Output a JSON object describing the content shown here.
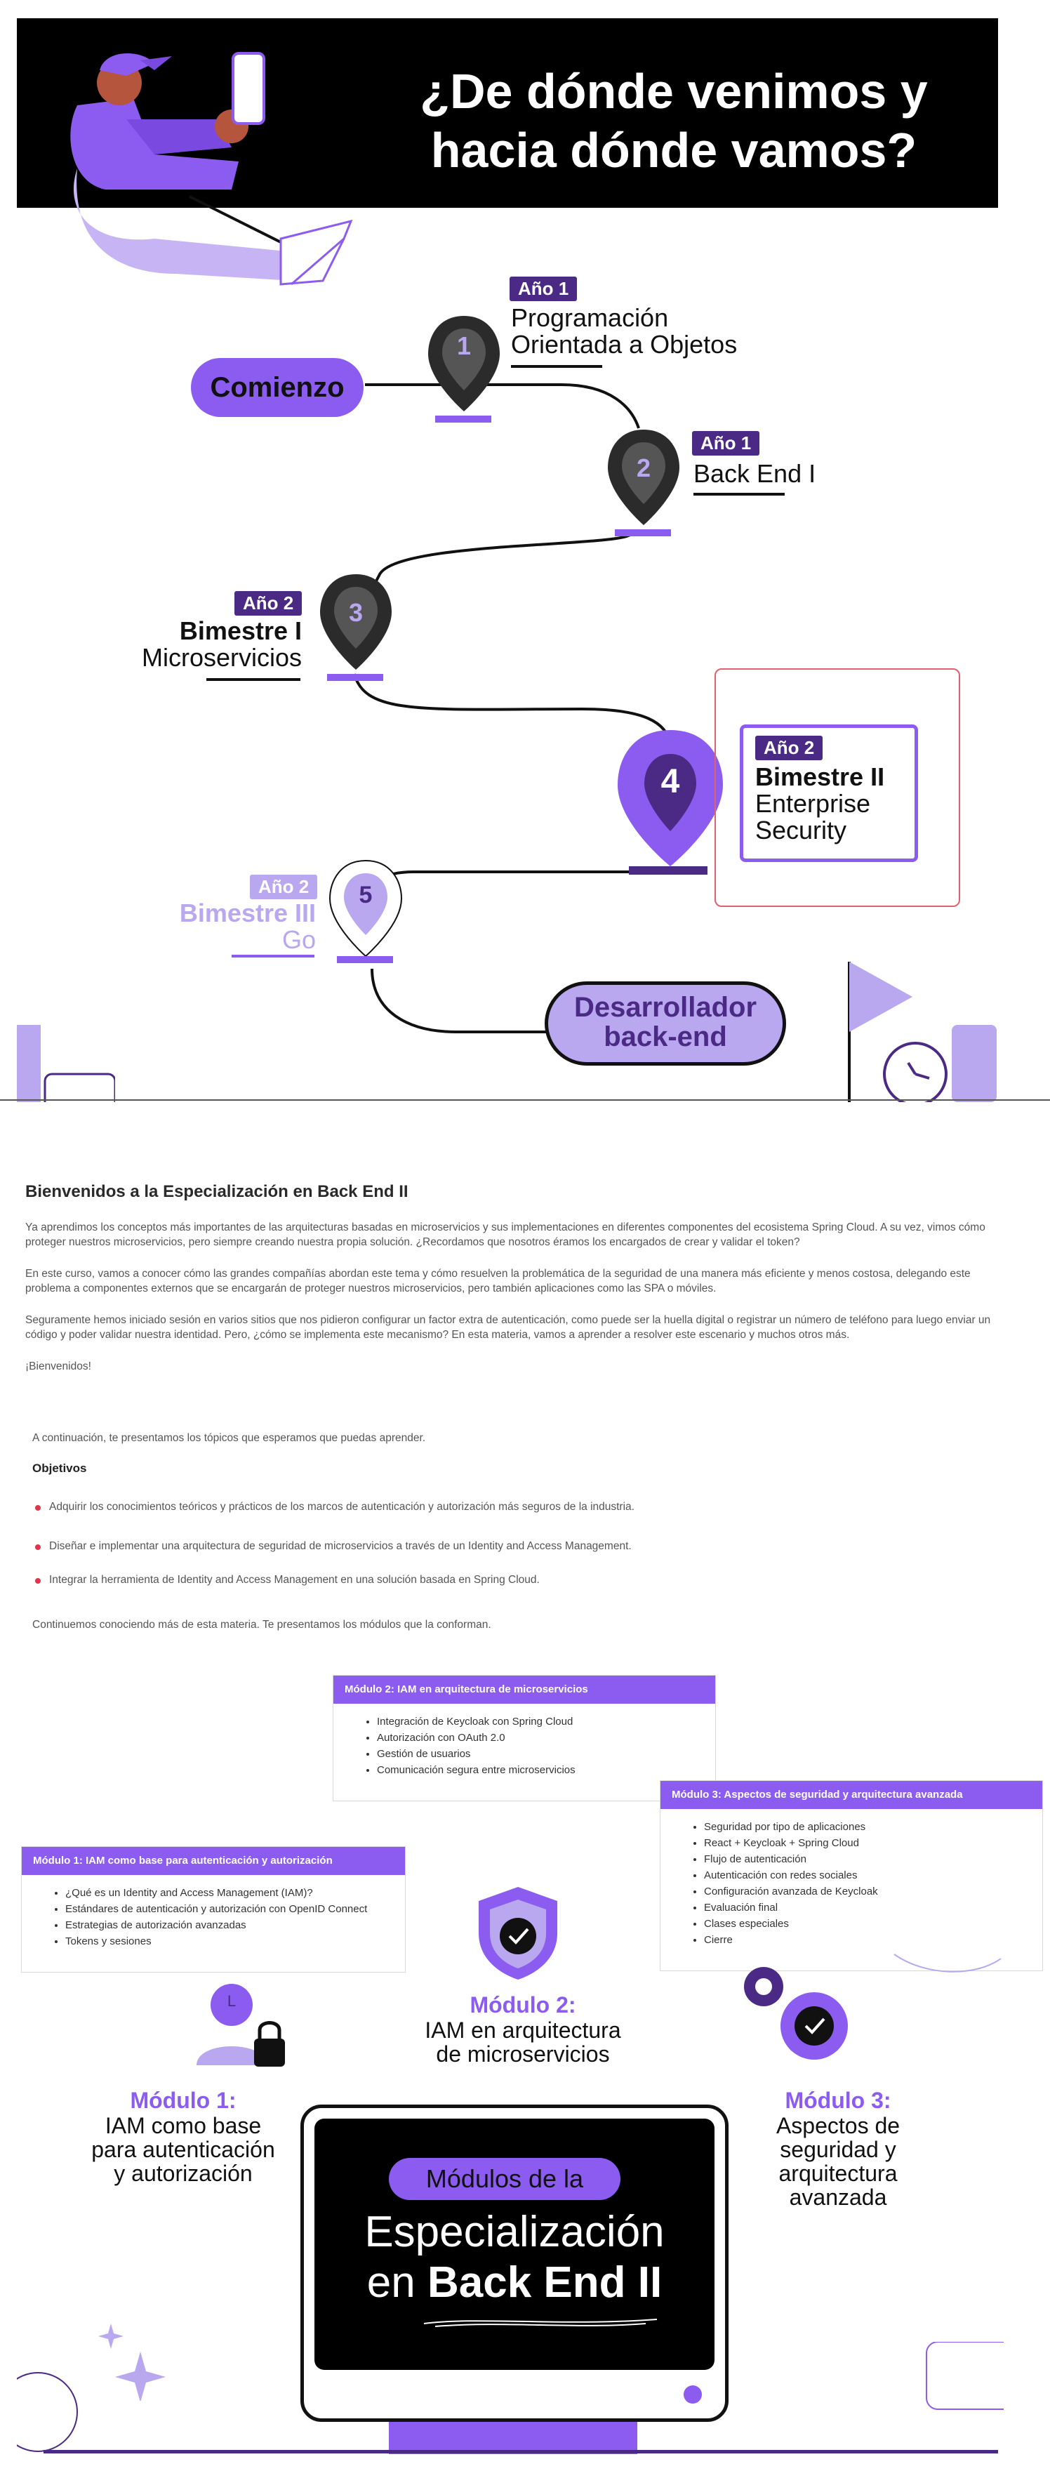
{
  "header": {
    "title_line1": "¿De dónde venimos y",
    "title_line2": "hacia dónde vamos?"
  },
  "roadmap": {
    "start_label": "Comienzo",
    "end_label_line1": "Desarrollador",
    "end_label_line2": "back-end",
    "milestones": [
      {
        "number": "1",
        "badge": "Año 1",
        "line1": "Programación",
        "line2": "Orientada a Objetos"
      },
      {
        "number": "2",
        "badge": "Año 1",
        "line1": "Back End I",
        "line2": ""
      },
      {
        "number": "3",
        "badge": "Año 2",
        "line1": "Bimestre I",
        "line2": "Microservicios"
      },
      {
        "number": "4",
        "badge": "Año 2",
        "line1": "Bimestre II",
        "line2": "Enterprise",
        "line3": "Security"
      },
      {
        "number": "5",
        "badge": "Año 2",
        "line1": "Bimestre III",
        "line2": "Go"
      }
    ]
  },
  "intro": {
    "title": "Bienvenidos a la Especialización en Back End II",
    "p1": "Ya aprendimos los conceptos más importantes de las arquitecturas basadas en microservicios y sus implementaciones en diferentes componentes del ecosistema Spring Cloud. A su vez, vimos cómo proteger nuestros microservicios, pero siempre creando nuestra propia solución. ¿Recordamos que nosotros éramos los encargados de crear y validar el token?",
    "p2": "En este curso, vamos a conocer cómo las grandes compañías abordan este tema y cómo resuelven la problemática de la seguridad de una manera más eficiente y menos costosa, delegando este problema a componentes externos que se encargarán de proteger nuestros microservicios, pero también aplicaciones como las SPA o móviles.",
    "p3": "Seguramente hemos iniciado sesión en varios sitios que nos pidieron configurar un factor extra de autenticación, como puede ser la huella digital o registrar un número de teléfono para luego enviar un código y poder validar nuestra identidad. Pero, ¿cómo se implementa este mecanismo? En esta materia, vamos a aprender a resolver este escenario y muchos otros más.",
    "p4": "¡Bienvenidos!",
    "lead": "A continuación, te presentamos los tópicos que esperamos que puedas aprender.",
    "objectives_title": "Objetivos",
    "objectives": [
      "Adquirir los conocimientos teóricos y prácticos de los marcos de autenticación y autorización más seguros de la industria.",
      "Diseñar e implementar una arquitectura de seguridad de microservicios a través de un Identity and Access Management.",
      "Integrar la herramienta de Identity and Access Management en una solución basada en Spring Cloud."
    ],
    "closing": "Continuemos conociendo más de esta materia. Te presentamos los módulos que la conforman."
  },
  "modules": {
    "m1": {
      "header": "Módulo 1: IAM como base para autenticación y autorización",
      "items": [
        "¿Qué es un Identity and Access Management (IAM)?",
        "Estándares de autenticación y autorización con OpenID Connect",
        "Estrategias de autorización avanzadas",
        "Tokens y sesiones"
      ],
      "label_title": "Módulo 1:",
      "label_line1": "IAM como base",
      "label_line2": "para autenticación",
      "label_line3": "y autorización"
    },
    "m2": {
      "header": "Módulo 2: IAM en arquitectura de microservicios",
      "items": [
        "Integración de Keycloak con Spring Cloud",
        "Autorización con OAuth 2.0",
        "Gestión de usuarios",
        "Comunicación segura entre microservicios"
      ],
      "label_title": "Módulo 2:",
      "label_line1": "IAM en arquitectura",
      "label_line2": "de microservicios"
    },
    "m3": {
      "header": "Módulo 3: Aspectos de seguridad y arquitectura avanzada",
      "items": [
        "Seguridad por tipo de aplicaciones",
        "React + Keycloak + Spring Cloud",
        "Flujo de autenticación",
        "Autenticación con redes sociales",
        "Configuración avanzada de Keycloak",
        "Evaluación final",
        "Clases especiales",
        "Cierre"
      ],
      "label_title": "Módulo 3:",
      "label_line1": "Aspectos de",
      "label_line2": "seguridad y",
      "label_line3": "arquitectura",
      "label_line4": "avanzada"
    },
    "monitor": {
      "pill": "Módulos de la",
      "line1": "Especialización",
      "line2_prefix": "en ",
      "line2_bold": "Back End II"
    },
    "avatar_letter": "L"
  },
  "colors": {
    "purple": "#8c5cf0",
    "dark_purple": "#4b2a86",
    "light_purple": "#b9a7f0",
    "black": "#000000",
    "bullet_red": "#e0344b"
  }
}
